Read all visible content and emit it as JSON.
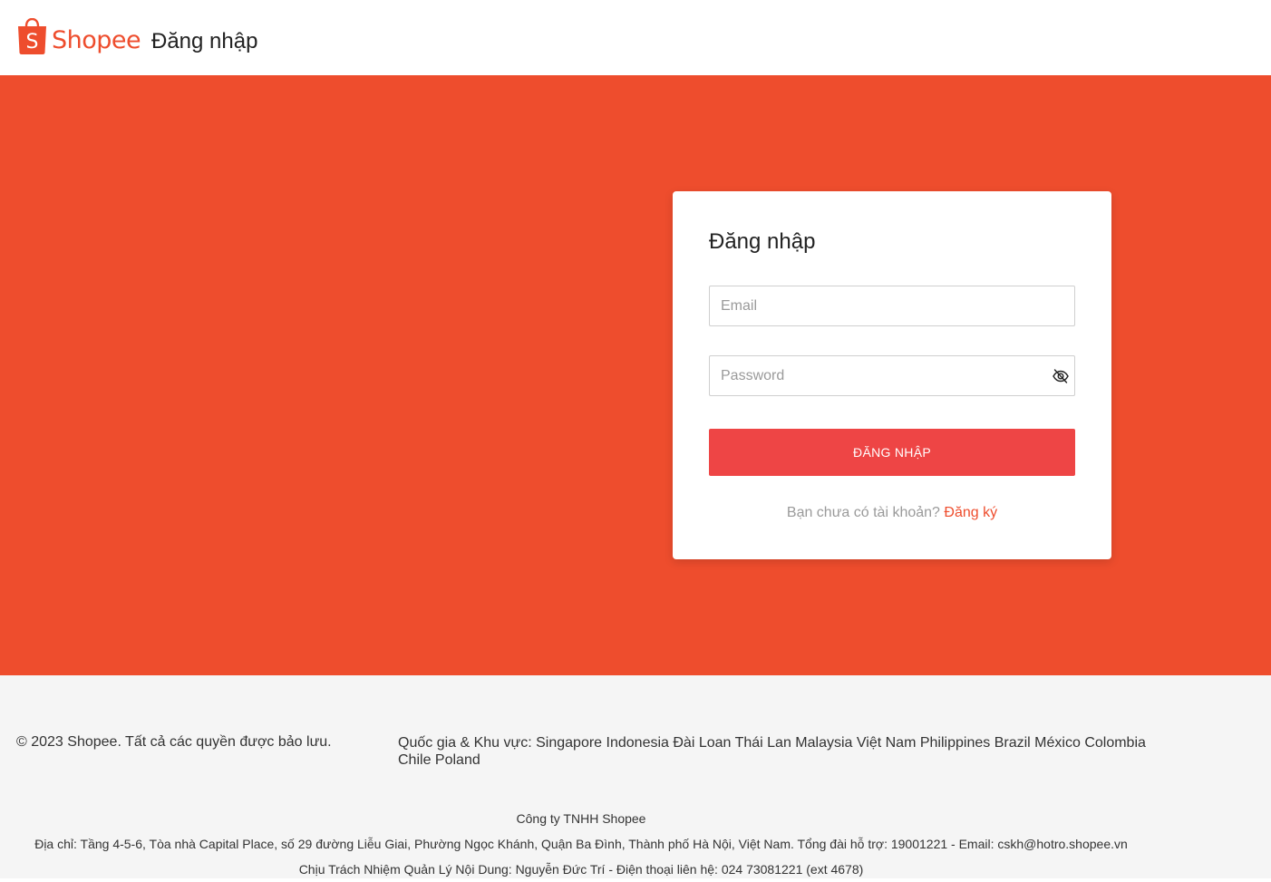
{
  "header": {
    "logo_text": "Shopee",
    "title": "Đăng nhập"
  },
  "login": {
    "title": "Đăng nhập",
    "email_placeholder": "Email",
    "password_placeholder": "Password",
    "submit_label": "ĐĂNG NHẬP",
    "signup_prompt": "Bạn chưa có tài khoản?",
    "signup_link": "Đăng ký",
    "password_visibility_icon": "eye-off-icon"
  },
  "footer": {
    "copyright": "© 2023 Shopee. Tất cả các quyền được bảo lưu.",
    "countries_label": "Quốc gia & Khu vực:",
    "countries": [
      "Singapore",
      "Indonesia",
      "Đài Loan",
      "Thái Lan",
      "Malaysia",
      "Việt Nam",
      "Philippines",
      "Brazil",
      "México",
      "Colombia",
      "Chile",
      "Poland"
    ],
    "company_name": "Công ty TNHH Shopee",
    "address": "Địa chỉ: Tầng 4-5-6, Tòa nhà Capital Place, số 29 đường Liễu Giai, Phường Ngọc Khánh, Quận Ba Đình, Thành phố Hà Nội, Việt Nam. Tổng đài hỗ trợ: 19001221 - Email: cskh@hotro.shopee.vn",
    "responsible": "Chịu Trách Nhiệm Quản Lý Nội Dung: Nguyễn Đức Trí - Điện thoại liên hệ: 024 73081221 (ext 4678)"
  },
  "colors": {
    "brand": "#ee4d2d",
    "button": "#ee4545",
    "footer_bg": "#f5f5f5"
  }
}
